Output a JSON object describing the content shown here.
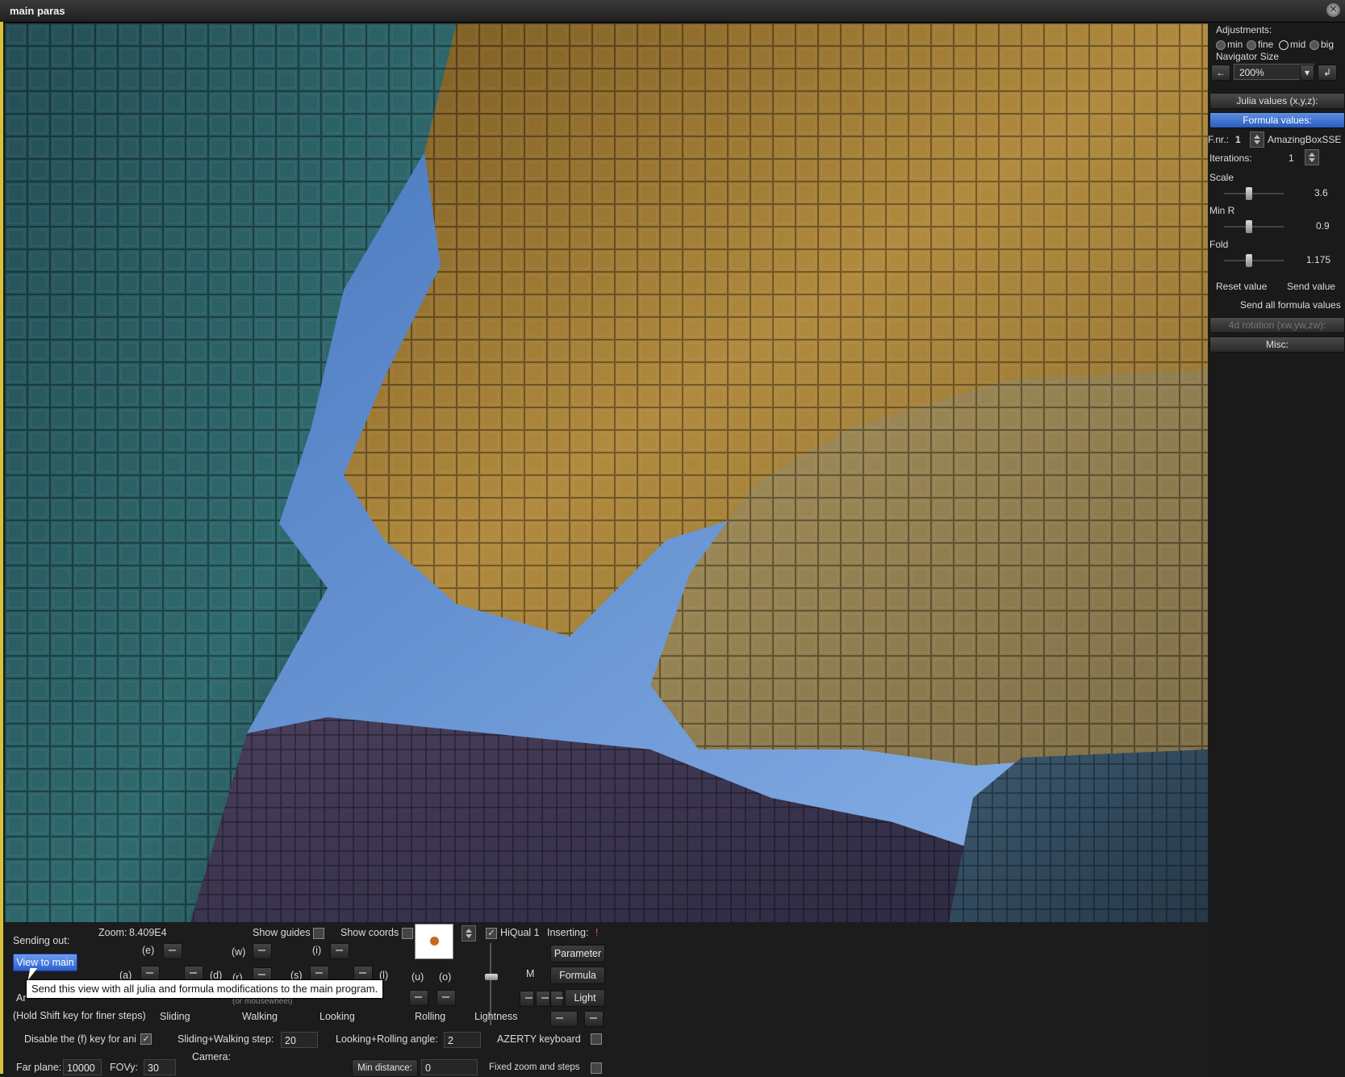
{
  "window": {
    "title": "main paras",
    "close_icon": "close-icon"
  },
  "right_panel": {
    "adjustments_label": "Adjustments:",
    "adjust_options": [
      "min",
      "fine",
      "mid",
      "big"
    ],
    "navigator_size_label": "Navigator Size",
    "navigator_size_value": "200%",
    "julia_button": "Julia values (x,y,z):",
    "formula_button": "Formula values:",
    "fnr_label": "F.nr.:",
    "fnr_value": "1",
    "formula_name": "AmazingBoxSSE",
    "iterations_label": "Iterations:",
    "iterations_value": "1",
    "scale_label": "Scale",
    "scale_value": "3.6",
    "minr_label": "Min R",
    "minr_value": "0.9",
    "fold_label": "Fold",
    "fold_value": "1.175",
    "reset_value": "Reset value",
    "send_value": "Send value",
    "send_all": "Send all formula values",
    "rotation_button": "4d rotation (xw,yw,zw):",
    "misc_button": "Misc:"
  },
  "bottom_panel": {
    "sending_out": "Sending out:",
    "zoom_label": "Zoom:",
    "zoom_value": "8.409E4",
    "show_guides": "Show guides",
    "show_coords": "Show coords",
    "hiqual": "HiQual 1",
    "inserting": "Inserting:",
    "inserting_mark": "!",
    "view_to_main": "View to main",
    "key_e": "(e)",
    "key_w": "(w)",
    "key_i": "(i)",
    "key_a": "(a)",
    "key_d": "(d)",
    "key_r": "(r)",
    "key_s": "(s)",
    "key_l": "(l)",
    "key_u": "(u)",
    "key_o": "(o)",
    "m_label": "M",
    "parameter": "Parameter",
    "formula": "Formula",
    "light": "Light",
    "ar_fragment": "Ar",
    "tooltip": "Send this view with all julia and formula modifications to the main program.",
    "hidden_hint": "(or mousewheel)",
    "hold_shift": "(Hold Shift key for finer steps)",
    "sliding": "Sliding",
    "walking": "Walking",
    "looking": "Looking",
    "rolling": "Rolling",
    "lightness": "Lightness",
    "disable_f": "Disable the (f) key for ani",
    "step_label": "Sliding+Walking step:",
    "step_value": "20",
    "angle_label": "Looking+Rolling angle:",
    "angle_value": "2",
    "azerty": "AZERTY keyboard",
    "far_plane_label": "Far plane:",
    "far_plane_value": "10000",
    "fov_label": "FOVy:",
    "fov_value": "30",
    "camera_label": "Camera:",
    "min_distance_button": "Min distance:",
    "min_distance_value": "0",
    "fixed_zoom": "Fixed zoom and steps"
  },
  "colors": {
    "accent_blue": "#2b5fd0",
    "sky": "#7aa6e0",
    "teal_blocks": "#2f6a6e",
    "gold_blocks": "#b08a3e",
    "purple_blocks": "#3b3650"
  }
}
